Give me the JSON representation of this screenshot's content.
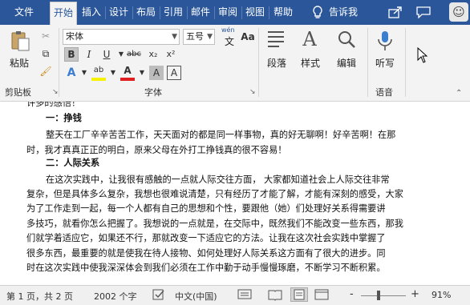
{
  "tabs": [
    {
      "label": "文件"
    },
    {
      "label": "开始"
    },
    {
      "label": "插入"
    },
    {
      "label": "设计"
    },
    {
      "label": "布局"
    },
    {
      "label": "引用"
    },
    {
      "label": "邮件"
    },
    {
      "label": "审阅"
    },
    {
      "label": "视图"
    },
    {
      "label": "帮助"
    }
  ],
  "active_tab": "开始",
  "tell_me": "告诉我",
  "ribbon": {
    "clipboard": {
      "paste_label": "粘贴",
      "group_label": "剪贴板"
    },
    "font": {
      "font_name": "宋体",
      "font_size": "五号",
      "wen_glyph": "wén",
      "wen_char": "文",
      "bold": "B",
      "italic": "I",
      "underline": "U",
      "strike": "abc",
      "subscript": "x₂",
      "superscript": "x²",
      "text_effects": "A",
      "highlight": "ab",
      "font_color": "A",
      "grow": "Aa",
      "char_shade": "A",
      "char_border": "A",
      "group_label": "字体"
    },
    "paragraph": {
      "label": "段落"
    },
    "styles": {
      "label": "样式"
    },
    "editing": {
      "label": "编辑"
    },
    "voice": {
      "dictate_label": "听写",
      "group_label": "语音"
    }
  },
  "document": {
    "lines": [
      "许多的感悟！",
      "一：挣钱",
      "整天在工厂辛辛苦苦工作，天天面对的都是同一样事物，真的好无聊啊！好辛苦啊！在那",
      "时，我才真真正正的明白，原来父母在外打工挣钱真的很不容易！",
      "二：人际关系",
      "在这次实践中，让我很有感触的一点就人际交往方面，  大家都知道社会上人际交往非常",
      "复杂，但是具体多么复杂，我想也很难说清楚，只有经历了才能了解，才能有深刻的感受，大家",
      "为了工作走到一起，每一个人都有自己的思想和个性，要跟他（她）们处理好关系得需要讲",
      "多技巧，就看你怎么把握了。我想说的一点就是，在交际中，既然我们不能改变一些东西，那我",
      "们就学着适应它，如果还不行，那就改变一下适应它的方法。让我在这次社会实践中掌握了",
      "很多东西，最重要的就是使我在待人接物、如何处理好人际关系这方面有了很大的进步。同",
      "时在这次实践中使我深深体会到我们必须在工作中勤于动手慢慢琢磨，不断学习不断积累。"
    ]
  },
  "status": {
    "page": "第 1 页，共 2 页",
    "words": "2002 个字",
    "language": "中文(中国)",
    "zoom_minus": "-",
    "zoom_plus": "+",
    "zoom": "91%"
  }
}
